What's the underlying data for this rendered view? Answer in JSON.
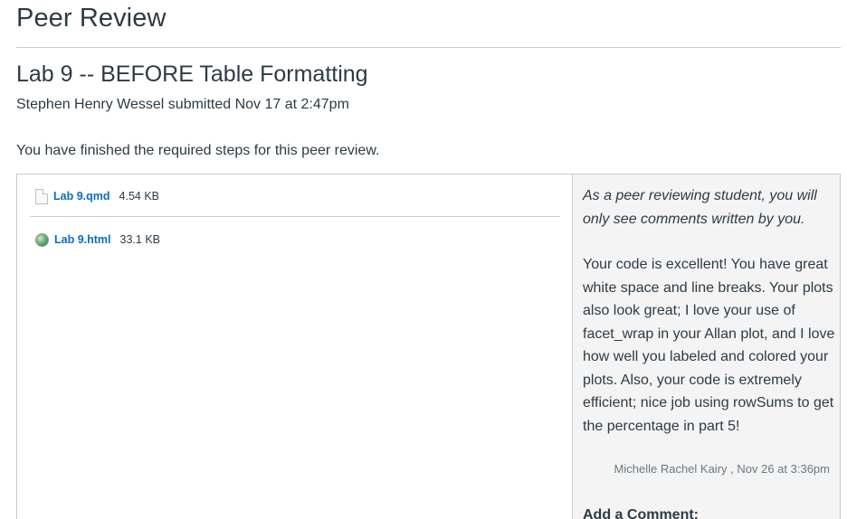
{
  "page": {
    "title": "Peer Review"
  },
  "assignment": {
    "title": "Lab 9 -- BEFORE Table Formatting",
    "submitted_line": "Stephen Henry Wessel submitted Nov 17 at 2:47pm",
    "status_message": "You have finished the required steps for this peer review."
  },
  "files": [
    {
      "name": "Lab 9.qmd",
      "size": "4.54 KB",
      "icon": "document-icon"
    },
    {
      "name": "Lab 9.html",
      "size": "33.1 KB",
      "icon": "globe-icon"
    }
  ],
  "comments": {
    "peer_note": "As a peer reviewing student, you will only see comments written by you.",
    "items": [
      {
        "text": "Your code is excellent! You have great white space and line breaks. Your plots also look great; I love your use of facet_wrap in your Allan plot, and I love how well you labeled and colored your plots. Also, your code is extremely efficient; nice job using rowSums to get the percentage in part 5!",
        "author": "Michelle Rachel Kairy",
        "date": ", Nov 26 at 3:36pm"
      }
    ],
    "add_comment_label": "Add a Comment:"
  }
}
